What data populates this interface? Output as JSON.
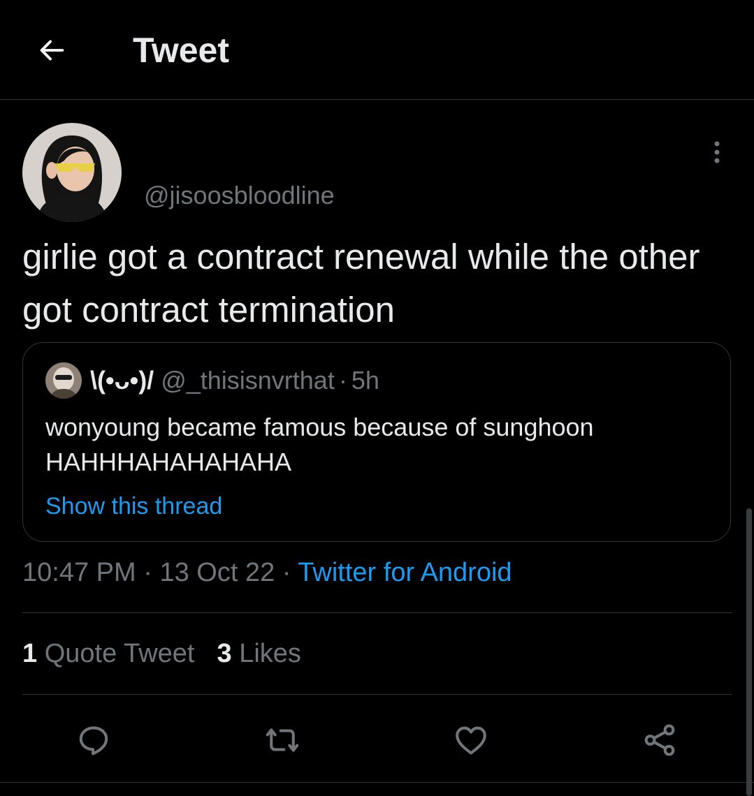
{
  "header": {
    "title": "Tweet",
    "back_icon": "arrow-left-icon"
  },
  "tweet": {
    "handle": "@jisoosbloodline",
    "text": "girlie got a contract renewal while the other got contract termination",
    "more_icon": "more-vertical-icon"
  },
  "quote": {
    "name": "\\(•ᴗ•)/",
    "handle": "@_thisisnvrthat",
    "separator": "·",
    "time": "5h",
    "text": "wonyoung became famous because of sunghoon HAHHHAHAHAHAHA",
    "link": "Show this thread"
  },
  "meta": {
    "time": "10:47 PM",
    "separator": "·",
    "date": "13 Oct 22",
    "source": "Twitter for Android"
  },
  "stats": {
    "quote_count": "1",
    "quote_label": "Quote Tweet",
    "like_count": "3",
    "like_label": "Likes"
  },
  "actions": {
    "reply_icon": "reply-icon",
    "retweet_icon": "retweet-icon",
    "like_icon": "heart-icon",
    "share_icon": "share-icon"
  },
  "colors": {
    "background": "#000000",
    "text": "#e7e9ea",
    "muted": "#71767b",
    "accent": "#1d9bf0",
    "border": "#2f3336"
  }
}
